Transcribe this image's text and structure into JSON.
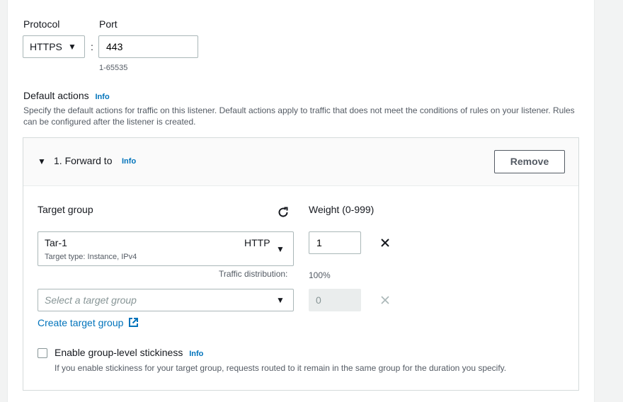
{
  "listener": {
    "protocol_label": "Protocol",
    "protocol_value": "HTTPS",
    "port_label": "Port",
    "port_separator": ":",
    "port_value": "443",
    "port_hint": "1-65535"
  },
  "default_actions": {
    "title": "Default actions",
    "info": "Info",
    "description": "Specify the default actions for traffic on this listener. Default actions apply to traffic that does not meet the conditions of rules on your listener. Rules can be configured after the listener is created."
  },
  "forward": {
    "title": "1. Forward to",
    "info": "Info",
    "remove_label": "Remove",
    "target_group_label": "Target group",
    "weight_label": "Weight (0-999)",
    "rows": [
      {
        "name": "Tar-1",
        "protocol": "HTTP",
        "meta": "Target type: Instance, IPv4",
        "weight": "1"
      }
    ],
    "traffic_label": "Traffic distribution:",
    "traffic_value": "100%",
    "empty_select_placeholder": "Select a target group",
    "empty_weight": "0",
    "create_link": "Create target group",
    "stickiness_label": "Enable group-level stickiness",
    "stickiness_info": "Info",
    "stickiness_help": "If you enable stickiness for your target group, requests routed to it remain in the same group for the duration you specify.",
    "stickiness_checked": false
  },
  "colors": {
    "link": "#0073bb",
    "border": "#aab7b8",
    "disabled_bg": "#eaeded"
  }
}
